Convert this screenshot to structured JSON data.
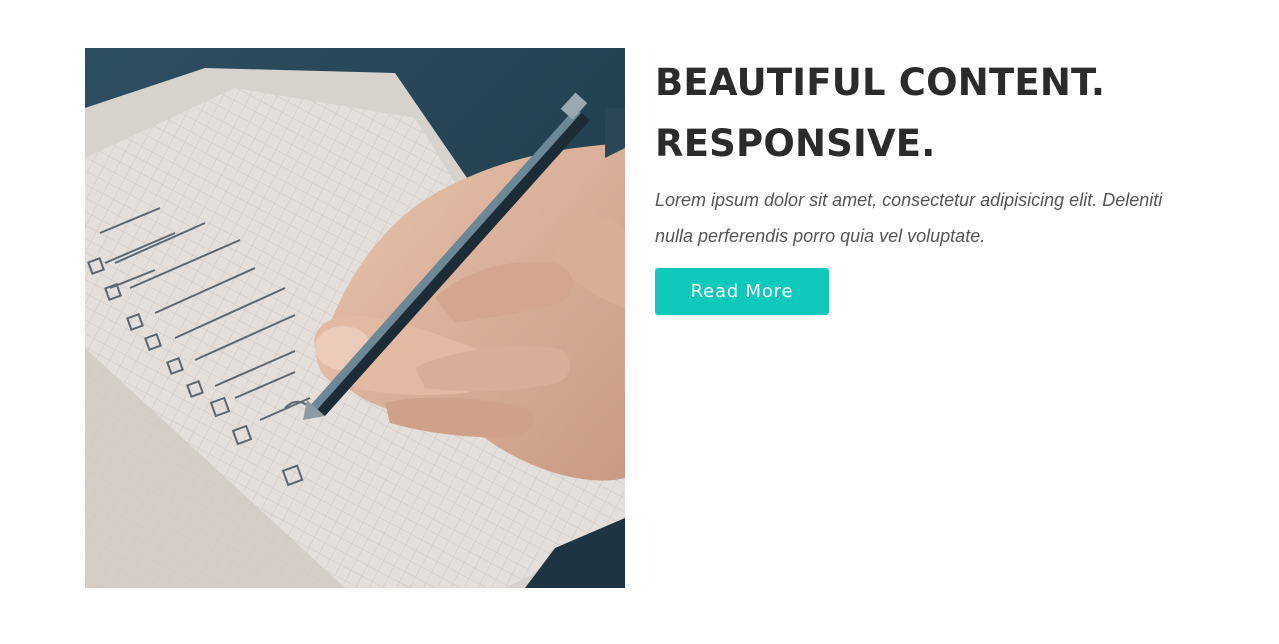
{
  "feature": {
    "heading_line1": "BEAUTIFUL CONTENT.",
    "heading_line2": "RESPONSIVE.",
    "description": "Lorem ipsum dolor sit amet, consectetur adipisicing elit. Deleniti nulla perferendis porro quia vel voluptate.",
    "button_label": "Read More",
    "image_alt": "Hand writing a checklist in a notebook with a pen"
  },
  "colors": {
    "accent": "#0cc9bc",
    "heading": "#2b2b2b",
    "text": "#555555"
  }
}
